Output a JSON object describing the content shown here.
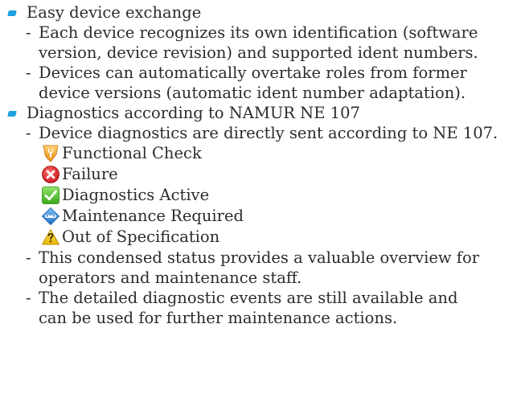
{
  "sections": [
    {
      "title": "Easy device exchange",
      "items": [
        {
          "lines": [
            "Each device recognizes its own identification (software",
            "version, device revision) and supported ident numbers."
          ]
        },
        {
          "lines": [
            "Devices can automatically overtake roles from former",
            "device versions (automatic ident number adaptation)."
          ]
        }
      ]
    },
    {
      "title": "Diagnostics according to NAMUR NE 107",
      "intro": "Device diagnostics are directly sent according to NE 107.",
      "statuses": [
        {
          "label": "Functional Check",
          "icon": "functional-check-icon",
          "color": "#f5a21b"
        },
        {
          "label": "Failure",
          "icon": "failure-icon",
          "color": "#e2232a"
        },
        {
          "label": "Diagnostics Active",
          "icon": "diagnostics-active-icon",
          "color": "#55c12d"
        },
        {
          "label": "Maintenance Required",
          "icon": "maintenance-required-icon",
          "color": "#2f82d4"
        },
        {
          "label": "Out of Specification",
          "icon": "out-of-specification-icon",
          "color": "#f4c400"
        }
      ],
      "items": [
        {
          "lines": [
            "This condensed status provides a valuable overview for",
            "operators and maintenance staff."
          ]
        },
        {
          "lines": [
            "The detailed diagnostic events are still available and",
            "can be used for further maintenance actions."
          ]
        }
      ]
    }
  ],
  "dash": "-"
}
